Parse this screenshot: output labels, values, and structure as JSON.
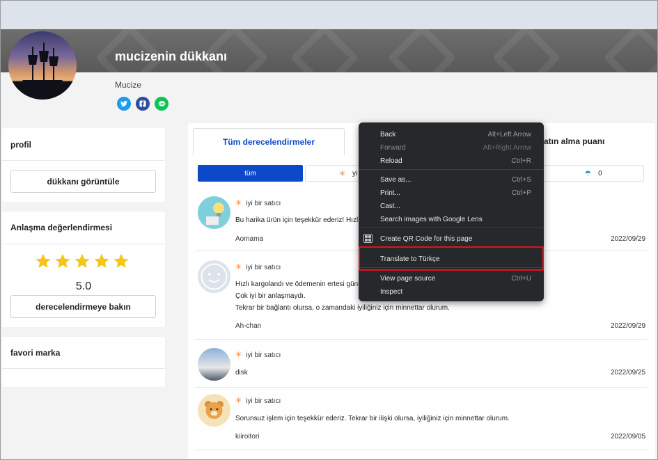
{
  "shop": {
    "title": "mucizenin dükkanı",
    "owner": "Mucize",
    "social": [
      {
        "icon": "twitter-icon",
        "color": "#1d9bf0"
      },
      {
        "icon": "facebook-icon",
        "color": "#1877f2"
      },
      {
        "icon": "line-icon",
        "color": "#06c755"
      }
    ]
  },
  "sidebar": {
    "profile": {
      "title": "profil",
      "button": "dükkanı görüntüle"
    },
    "rating": {
      "title": "Anlaşma değerlendirmesi",
      "stars": 5,
      "score": "5.0",
      "button": "derecelendirmeye bakın"
    },
    "favorite": {
      "title": "favori marka"
    }
  },
  "tabs": {
    "all": "Tüm derecelendirmeler",
    "purchase": "atın alma puanı"
  },
  "filters": {
    "all": "tüm",
    "good_partial": "yi",
    "bad_count": "0"
  },
  "reviews": [
    {
      "rating": "iyi bir satıcı",
      "text": [
        "Bu harika ürün için teşekkür ederiz! Hızlı"
      ],
      "name": "Aomama",
      "date": "2022/09/29"
    },
    {
      "rating": "iyi bir satıcı",
      "text": [
        "Hızlı kargolandı ve ödemenin ertesi günü",
        "Çok iyi bir anlaşmaydı.",
        "Tekrar bir bağlantı olursa, o zamandaki iyiliğiniz için minnettar olurum."
      ],
      "name": "Ah-chan",
      "date": "2022/09/29"
    },
    {
      "rating": "iyi bir satıcı",
      "text": [],
      "name": "disk",
      "date": "2022/09/25"
    },
    {
      "rating": "iyi bir satıcı",
      "text": [
        "Sorunsuz işlem için teşekkür ederiz. Tekrar bir ilişki olursa, iyiliğiniz için minnettar olurum."
      ],
      "name": "kiiroitori",
      "date": "2022/09/05"
    }
  ],
  "context_menu": {
    "items": [
      {
        "label": "Back",
        "shortcut": "Alt+Left Arrow",
        "disabled": false
      },
      {
        "label": "Forward",
        "shortcut": "Alt+Right Arrow",
        "disabled": true
      },
      {
        "label": "Reload",
        "shortcut": "Ctrl+R",
        "disabled": false
      },
      {
        "label": "Save as...",
        "shortcut": "Ctrl+S",
        "disabled": false
      },
      {
        "label": "Print...",
        "shortcut": "Ctrl+P",
        "disabled": false
      },
      {
        "label": "Cast...",
        "shortcut": "",
        "disabled": false
      },
      {
        "label": "Search images with Google Lens",
        "shortcut": "",
        "disabled": false
      },
      {
        "label": "Create QR Code for this page",
        "shortcut": "",
        "disabled": false
      },
      {
        "label": "Translate to Türkçe",
        "shortcut": "",
        "disabled": false
      },
      {
        "label": "View page source",
        "shortcut": "Ctrl+U",
        "disabled": false
      },
      {
        "label": "Inspect",
        "shortcut": "",
        "disabled": false
      }
    ]
  },
  "colors": {
    "accent_blue": "#0b49c8",
    "rating_orange": "#f07b28",
    "star_yellow": "#f5c518",
    "highlight_red": "#e0111b"
  }
}
